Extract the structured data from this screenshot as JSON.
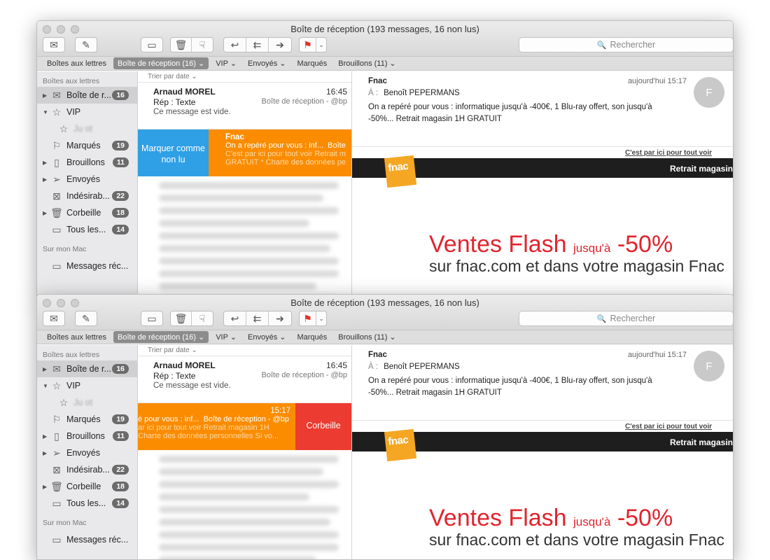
{
  "window": {
    "title": "Boîte de réception (193 messages, 16 non lus)"
  },
  "toolbar": {
    "search_placeholder": "Rechercher"
  },
  "favorites": [
    {
      "label": "Boîtes aux lettres"
    },
    {
      "label": "Boîte de réception (16) ⌄"
    },
    {
      "label": "VIP ⌄"
    },
    {
      "label": "Envoyés ⌄"
    },
    {
      "label": "Marqués"
    },
    {
      "label": "Brouillons (11) ⌄"
    }
  ],
  "sidebar": {
    "header": "Boîtes aux lettres",
    "items": [
      {
        "label": "Boîte de r...",
        "count": "16"
      },
      {
        "label": "VIP"
      },
      {
        "label": "Ju          ot"
      },
      {
        "label": "Marqués",
        "count": "19"
      },
      {
        "label": "Brouillons",
        "count": "11"
      },
      {
        "label": "Envoyés"
      },
      {
        "label": "Indésirab...",
        "count": "22"
      },
      {
        "label": "Corbeille",
        "count": "18"
      },
      {
        "label": "Tous les...",
        "count": "14"
      }
    ],
    "section2": "Sur mon Mac",
    "mac_items": [
      {
        "label": "Messages réc..."
      }
    ]
  },
  "list": {
    "sort_label": "Trier par date ⌄",
    "message1": {
      "from": "Arnaud MOREL",
      "time": "16:45",
      "subject": "Rép : Texte",
      "mailbox": "Boîte de réception - @bp",
      "preview": "Ce message est vide."
    },
    "swipe_left": {
      "action": "Marquer comme non lu",
      "from": "Fnac",
      "line2": "On a repéré pour vous : inf...",
      "mailbox": "Boîte",
      "line3": "C'est par ici pour tout voir Retrait m",
      "line4": "GRATUIT * Charte des données pe"
    },
    "swipe_right": {
      "time": "15:17",
      "line2": "é pour vous : inf...",
      "mailbox": "Boîte de réception - @bp",
      "line3": "ar ici pour tout voir Retrait magasin 1H",
      "line4": "Charte des données personnelles Si vo...",
      "action": "Corbeille"
    }
  },
  "reader": {
    "from": "Fnac",
    "date": "aujourd'hui 15:17",
    "to_label": "À :",
    "to": "Benoît PEPERMANS",
    "snippet": "On a repéré pour vous : informatique jusqu'à -400€, 1 Blu-ray offert, son jusqu'à -50%... Retrait magasin 1H GRATUIT",
    "avatar_initial": "F",
    "link": "C'est par ici pour tout voir",
    "bar_text": "Retrait magasin",
    "logo_text": "fnac",
    "promo_title": "Ventes Flash",
    "promo_small": "jusqu'à",
    "promo_pct": "-50%",
    "promo_sub": "sur fnac.com et dans votre magasin Fnac"
  },
  "colors": {
    "blue": "#2f9fe6",
    "orange": "#fb8c00",
    "red": "#ec3b30",
    "promo_red": "#e1242e"
  }
}
